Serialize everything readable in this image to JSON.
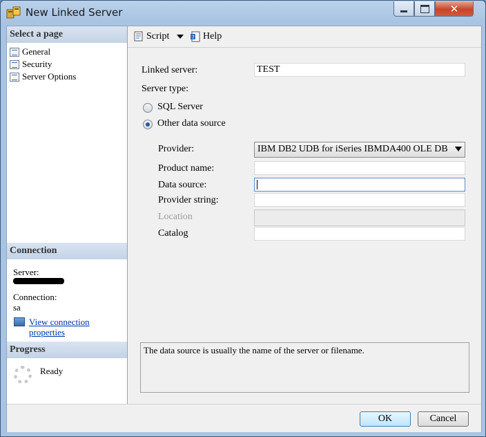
{
  "window": {
    "title": "New Linked Server"
  },
  "left": {
    "select_page_header": "Select a page",
    "pages": [
      "General",
      "Security",
      "Server Options"
    ],
    "connection_header": "Connection",
    "server_label": "Server:",
    "connection_label": "Connection:",
    "connection_value": "sa",
    "view_props_line1": "View connection",
    "view_props_line2": "properties",
    "progress_header": "Progress",
    "progress_status": "Ready"
  },
  "toolbar": {
    "script_label": "Script",
    "help_label": "Help"
  },
  "form": {
    "linked_server_label": "Linked server:",
    "linked_server_value": "TEST",
    "server_type_label": "Server type:",
    "sql_server_label": "SQL Server",
    "other_source_label": "Other data source",
    "selected_server_type": "Other data source",
    "provider_label": "Provider:",
    "provider_value": "IBM DB2 UDB for iSeries IBMDA400 OLE DB",
    "product_name_label": "Product name:",
    "product_name_value": "",
    "data_source_label": "Data source:",
    "data_source_value": "",
    "provider_string_label": "Provider string:",
    "provider_string_value": "",
    "location_label": "Location",
    "location_value": "",
    "catalog_label": "Catalog",
    "catalog_value": "",
    "description": "The data source is usually the name of the server or filename."
  },
  "buttons": {
    "ok": "OK",
    "cancel": "Cancel"
  }
}
